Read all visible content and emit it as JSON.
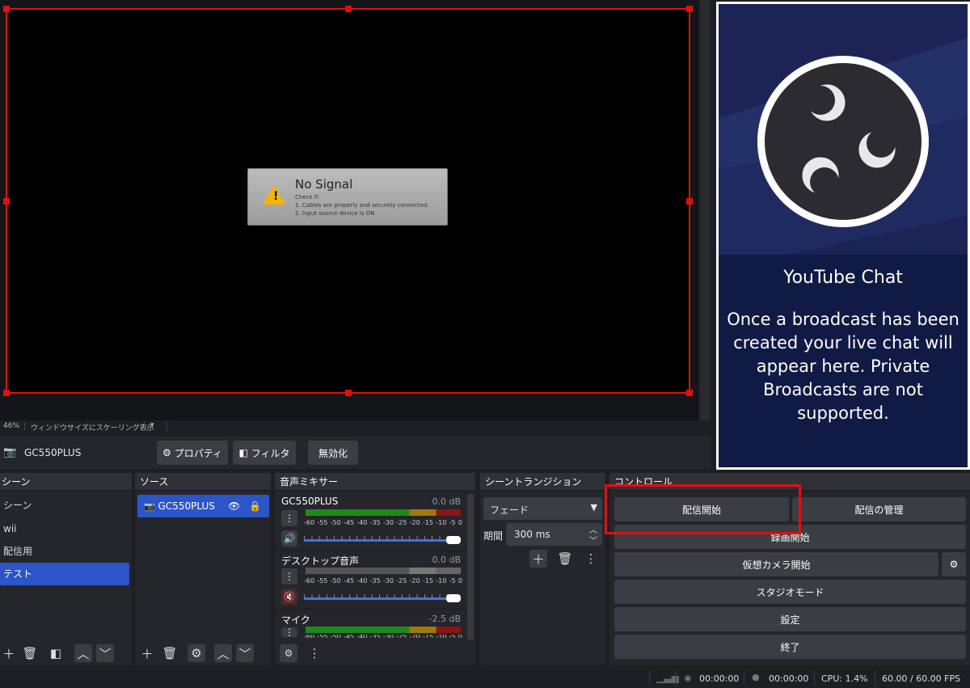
{
  "preview": {
    "nosignal_title": "No Signal",
    "nosignal_check": "Check if:",
    "nosignal_line1": "1. Cables are properly and securely connected.",
    "nosignal_line2": "2. Input source device is ON"
  },
  "scale_bar": {
    "zoom": "46%",
    "mode": "ウィンドウサイズにスケーリング表示"
  },
  "chat": {
    "title": "YouTube Chat",
    "body": "Once a broadcast has been created your live chat will appear here. Private Broadcasts are not supported."
  },
  "source_toolbar": {
    "source_name": "GC550PLUS",
    "properties_label": "プロパティ",
    "filters_label": "フィルタ",
    "disable_label": "無効化"
  },
  "scenes": {
    "title": "シーン",
    "items": [
      "シーン",
      "wii",
      "配信用",
      "テスト"
    ]
  },
  "sources": {
    "title": "ソース",
    "items": [
      "GC550PLUS"
    ]
  },
  "mixer": {
    "title": "音声ミキサー",
    "scale": [
      "-60",
      "-55",
      "-50",
      "-45",
      "-40",
      "-35",
      "-30",
      "-25",
      "-20",
      "-15",
      "-10",
      "-5",
      "0"
    ],
    "channels": [
      {
        "name": "GC550PLUS",
        "db": "0.0 dB",
        "level": 1.0,
        "muted": false
      },
      {
        "name": "デスクトップ音声",
        "db": "0.0 dB",
        "level": 1.0,
        "muted": true
      },
      {
        "name": "マイク",
        "db": "-2.5 dB",
        "level": 1.0,
        "muted": false
      }
    ]
  },
  "transitions": {
    "title": "シーントランジション",
    "selected": "フェード",
    "duration_label": "期間",
    "duration_value": "300 ms"
  },
  "controls": {
    "title": "コントロール",
    "start_streaming": "配信開始",
    "manage_broadcast": "配信の管理",
    "start_recording": "録画開始",
    "start_virtualcam": "仮想カメラ開始",
    "studio_mode": "スタジオモード",
    "settings": "設定",
    "exit": "終了"
  },
  "status": {
    "stream_time": "00:00:00",
    "record_time": "00:00:00",
    "cpu": "CPU: 1.4%",
    "fps": "60.00 / 60.00 FPS"
  },
  "colors": {
    "selection": "#2b55c8",
    "highlight_box": "#e01010",
    "chat_bg": "#1b2454"
  }
}
